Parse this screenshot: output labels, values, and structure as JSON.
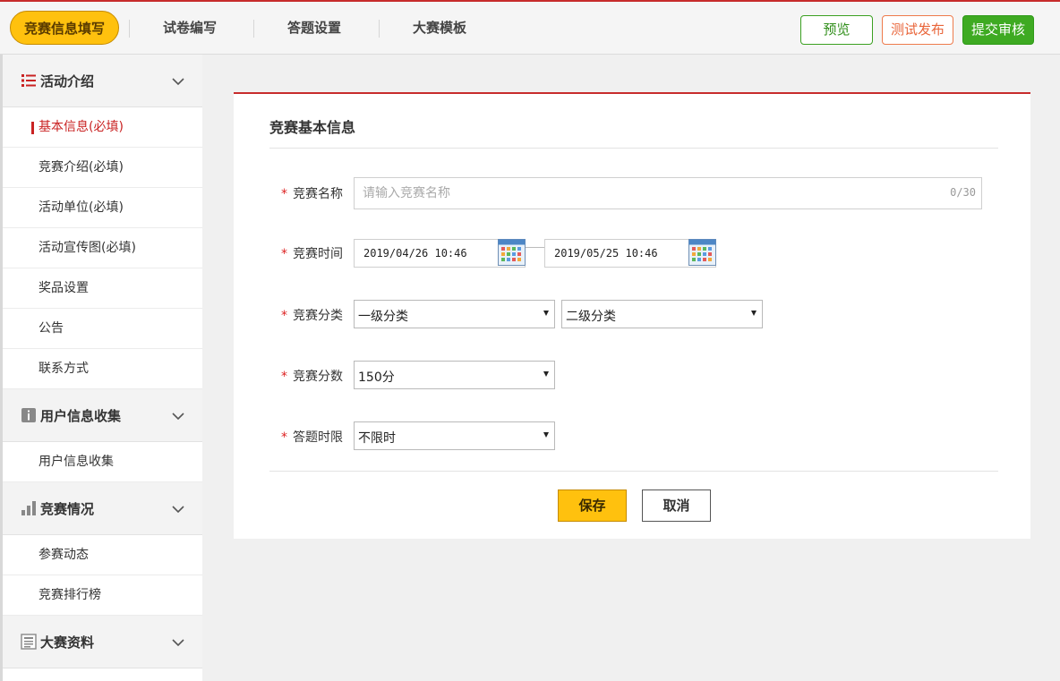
{
  "topbar": {
    "tabs": [
      {
        "label": "竞赛信息填写",
        "active": true
      },
      {
        "label": "试卷编写",
        "active": false
      },
      {
        "label": "答题设置",
        "active": false
      },
      {
        "label": "大赛模板",
        "active": false
      }
    ],
    "preview_label": "预览",
    "test_publish_label": "测试发布",
    "submit_review_label": "提交审核"
  },
  "sidebar": {
    "groups": [
      {
        "title": "活动介绍",
        "icon": "list-icon",
        "expanded": true,
        "items": [
          {
            "label": "基本信息(必填)",
            "active": true
          },
          {
            "label": "竞赛介绍(必填)"
          },
          {
            "label": "活动单位(必填)"
          },
          {
            "label": "活动宣传图(必填)"
          },
          {
            "label": "奖品设置"
          },
          {
            "label": "公告"
          },
          {
            "label": "联系方式"
          }
        ]
      },
      {
        "title": "用户信息收集",
        "icon": "info-icon",
        "expanded": true,
        "items": [
          {
            "label": "用户信息收集"
          }
        ]
      },
      {
        "title": "竞赛情况",
        "icon": "bar-chart-icon",
        "expanded": true,
        "items": [
          {
            "label": "参赛动态"
          },
          {
            "label": "竞赛排行榜"
          }
        ]
      },
      {
        "title": "大赛资料",
        "icon": "document-icon",
        "expanded": true,
        "items": []
      }
    ]
  },
  "form": {
    "title": "竞赛基本信息",
    "required_mark": "*",
    "name": {
      "label": "竞赛名称",
      "placeholder": "请输入竞赛名称",
      "value": "",
      "counter": "0/30"
    },
    "time": {
      "label": "竞赛时间",
      "start": "2019/04/26 10:46",
      "end": "2019/05/25 10:46"
    },
    "category": {
      "label": "竞赛分类",
      "level1": "一级分类",
      "level2": "二级分类"
    },
    "score": {
      "label": "竞赛分数",
      "value": "150分"
    },
    "time_limit": {
      "label": "答题时限",
      "value": "不限时"
    },
    "save_label": "保存",
    "cancel_label": "取消"
  },
  "colors": {
    "accent_red": "#c72c2c",
    "tab_active": "#ffc10e",
    "preview_green": "#2f8e19",
    "test_orange": "#e9653a",
    "submit_green": "#3eaa22"
  }
}
